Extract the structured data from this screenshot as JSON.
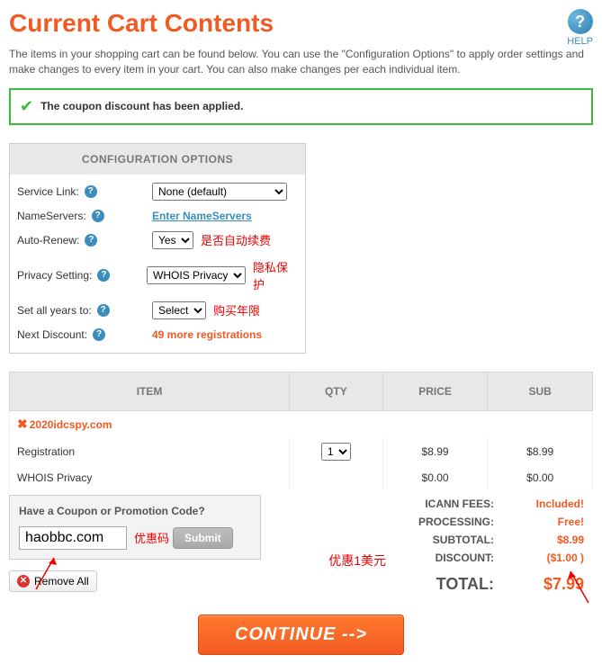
{
  "header": {
    "title": "Current Cart Contents",
    "help_label": "HELP"
  },
  "intro": "The items in your shopping cart can be found below. You can use the \"Configuration Options\" to apply order settings and make changes to every item in your cart. You can also make changes per each individual item.",
  "alert": "The coupon discount has been applied.",
  "config": {
    "heading": "CONFIGURATION OPTIONS",
    "rows": {
      "service_link": {
        "label": "Service Link:",
        "value": "None (default)"
      },
      "nameservers": {
        "label": "NameServers:",
        "value": "Enter NameServers"
      },
      "auto_renew": {
        "label": "Auto-Renew:",
        "value": "Yes",
        "annot": "是否自动续费"
      },
      "privacy": {
        "label": "Privacy Setting:",
        "value": "WHOIS Privacy",
        "annot": "隐私保护"
      },
      "years": {
        "label": "Set all years to:",
        "value": "Select",
        "annot": "购买年限"
      },
      "next_discount": {
        "label": "Next Discount:",
        "value": "49 more registrations"
      }
    }
  },
  "table": {
    "headers": [
      "ITEM",
      "QTY",
      "PRICE",
      "SUB"
    ],
    "domain": "2020idcspy.com",
    "lines": [
      {
        "item": "Registration",
        "qty": "1",
        "price": "$8.99",
        "sub": "$8.99"
      },
      {
        "item": "WHOIS Privacy",
        "qty": "",
        "price": "$0.00",
        "sub": "$0.00"
      }
    ]
  },
  "coupon": {
    "title": "Have a Coupon or Promotion Code?",
    "value": "haobbc.com",
    "annot": "优惠码",
    "submit": "Submit"
  },
  "remove_all": "Remove All",
  "totals": {
    "icann": {
      "label": "ICANN FEES:",
      "value": "Included!"
    },
    "processing": {
      "label": "PROCESSING:",
      "value": "Free!"
    },
    "subtotal": {
      "label": "SUBTOTAL:",
      "value": "$8.99"
    },
    "discount": {
      "label": "DISCOUNT:",
      "value": "($1.00 )",
      "annot": "优惠1美元"
    },
    "total": {
      "label": "TOTAL:",
      "value": "$7.99"
    }
  },
  "continue": "CONTINUE -->"
}
